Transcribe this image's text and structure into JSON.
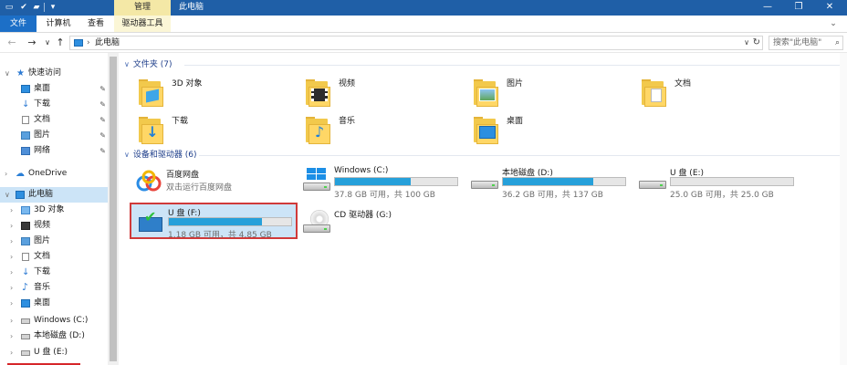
{
  "window": {
    "title": "此电脑",
    "context_tab": "管理",
    "controls": {
      "minimize": "—",
      "restore": "❐",
      "close": "✕"
    }
  },
  "ribbon": {
    "file": "文件",
    "tabs": [
      "计算机",
      "查看",
      "驱动器工具"
    ],
    "expand": "⌄"
  },
  "address": {
    "path_sep": "›",
    "path": "此电脑",
    "dropdown": "∨",
    "refresh": "↻",
    "search_placeholder": "搜索\"此电脑\"",
    "search_icon": "⌕"
  },
  "nav": {
    "quick_access": "快速访问",
    "quick_items": [
      {
        "label": "桌面",
        "icon": "desktop-icon"
      },
      {
        "label": "下载",
        "icon": "download-icon"
      },
      {
        "label": "文档",
        "icon": "document-icon"
      },
      {
        "label": "图片",
        "icon": "pictures-icon"
      },
      {
        "label": "网络",
        "icon": "network-icon"
      }
    ],
    "pin": "📌",
    "onedrive": "OneDrive",
    "this_pc": "此电脑",
    "pc_items": [
      {
        "label": "3D 对象",
        "icon": "3d-objects-icon"
      },
      {
        "label": "视频",
        "icon": "videos-icon"
      },
      {
        "label": "图片",
        "icon": "pictures-icon"
      },
      {
        "label": "文档",
        "icon": "document-icon"
      },
      {
        "label": "下载",
        "icon": "download-icon"
      },
      {
        "label": "音乐",
        "icon": "music-icon"
      },
      {
        "label": "桌面",
        "icon": "desktop-icon"
      },
      {
        "label": "Windows (C:)",
        "icon": "drive-c-icon"
      },
      {
        "label": "本地磁盘 (D:)",
        "icon": "drive-icon"
      },
      {
        "label": "U 盘 (E:)",
        "icon": "drive-icon"
      }
    ]
  },
  "folders_group": {
    "header": "文件夹 (7)",
    "items": [
      {
        "label": "3D 对象",
        "icon": "3d-objects-folder-icon"
      },
      {
        "label": "视频",
        "icon": "videos-folder-icon"
      },
      {
        "label": "图片",
        "icon": "pictures-folder-icon"
      },
      {
        "label": "文档",
        "icon": "documents-folder-icon"
      },
      {
        "label": "下载",
        "icon": "downloads-folder-icon"
      },
      {
        "label": "音乐",
        "icon": "music-folder-icon"
      },
      {
        "label": "桌面",
        "icon": "desktop-folder-icon"
      }
    ]
  },
  "devices_group": {
    "header": "设备和驱动器 (6)",
    "baidu": {
      "name": "百度网盘",
      "sub": "双击运行百度网盘"
    },
    "drives": [
      {
        "name": "Windows (C:)",
        "free": "37.8 GB 可用，共 100 GB",
        "used_fraction": 0.62
      },
      {
        "name": "本地磁盘 (D:)",
        "free": "36.2 GB 可用，共 137 GB",
        "used_fraction": 0.74
      },
      {
        "name": "U 盘 (E:)",
        "free": "25.0 GB 可用，共 25.0 GB",
        "used_fraction": 0.0
      },
      {
        "name": "U 盘 (F:)",
        "free": "1.18 GB 可用，共 4.85 GB",
        "used_fraction": 0.76
      }
    ],
    "cd": {
      "name": "CD 驱动器 (G:)"
    }
  },
  "colors": {
    "title_bar": "#1f5fa7",
    "accent": "#26a0da",
    "selection": "#cce4f7",
    "highlight_border": "#d03a3a"
  }
}
